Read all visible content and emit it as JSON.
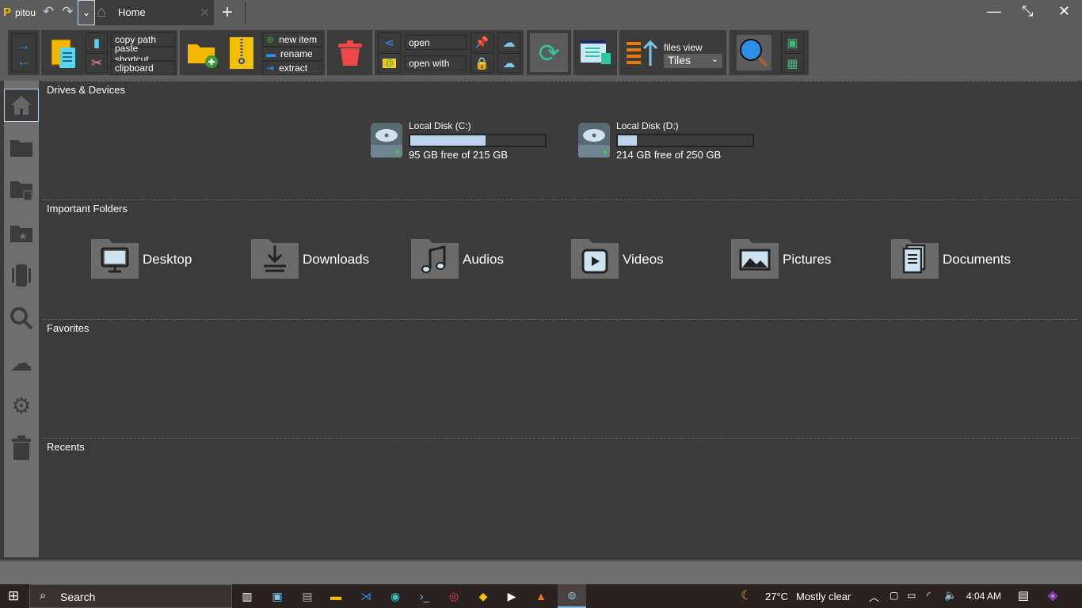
{
  "app": {
    "name": "pitou",
    "tab_label": "Home"
  },
  "toolbar": {
    "copy_path": "copy path",
    "paste_shortcut": "paste shortcut",
    "clipboard": "clipboard",
    "new_item": "new item",
    "rename": "rename",
    "extract": "extract",
    "open": "open",
    "open_with": "open with",
    "files_view_label": "files view",
    "files_view_value": "Tiles"
  },
  "sections": {
    "drives": "Drives & Devices",
    "important": "Important Folders",
    "favorites": "Favorites",
    "recents": "Recents"
  },
  "drives": [
    {
      "name": "Local Disk (C:)",
      "info": "95 GB free of 215 GB",
      "used_fraction": 0.56
    },
    {
      "name": "Local Disk (D:)",
      "info": "214 GB free of 250 GB",
      "used_fraction": 0.14
    }
  ],
  "folders": [
    {
      "label": "Desktop"
    },
    {
      "label": "Downloads"
    },
    {
      "label": "Audios"
    },
    {
      "label": "Videos"
    },
    {
      "label": "Pictures"
    },
    {
      "label": "Documents"
    }
  ],
  "taskbar": {
    "search": "Search",
    "weather": "27°C",
    "weather_desc": "Mostly clear",
    "time": "4:04 AM"
  },
  "colors": {
    "accent": "#bcd4ec",
    "toolbar_bg": "#5c5c5c",
    "panel_bg": "#3b3b3b"
  }
}
